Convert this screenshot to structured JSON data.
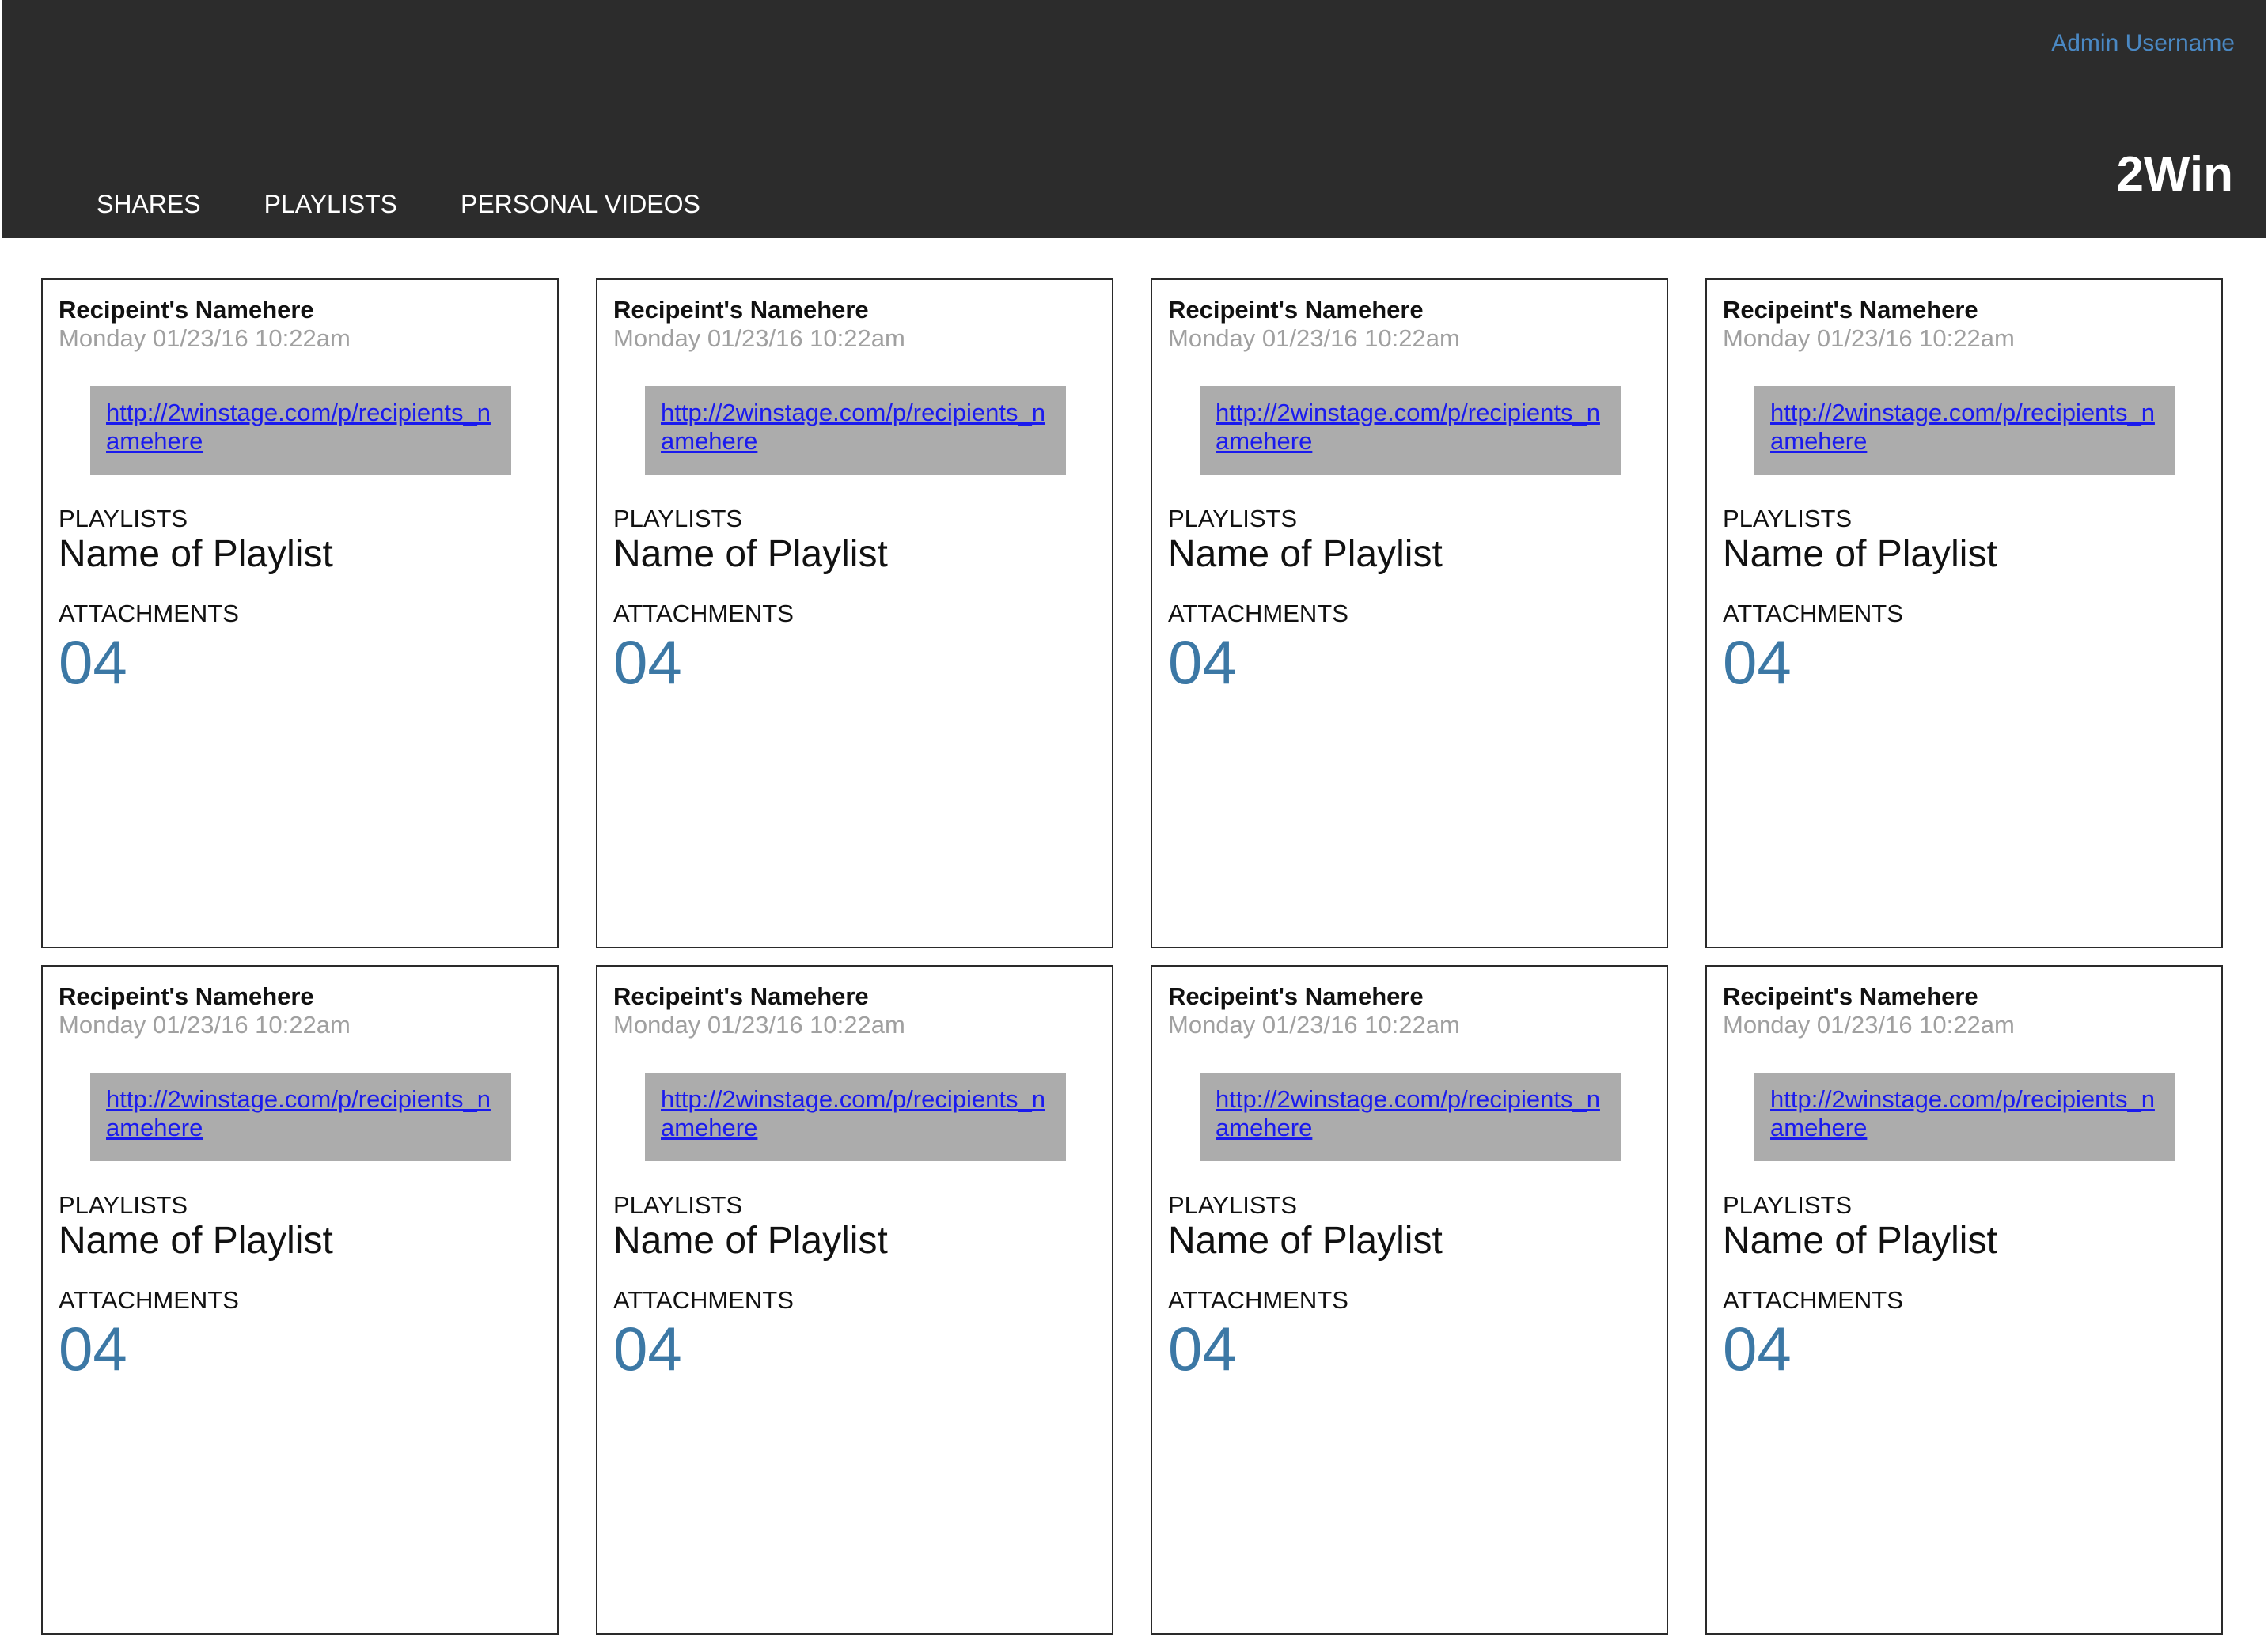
{
  "header": {
    "admin_username": "Admin Username",
    "brand": "2Win",
    "nav": [
      {
        "label": "SHARES"
      },
      {
        "label": "PLAYLISTS"
      },
      {
        "label": "PERSONAL VIDEOS"
      }
    ]
  },
  "labels": {
    "playlists": "PLAYLISTS",
    "attachments": "ATTACHMENTS"
  },
  "cards": [
    {
      "name": "Recipeint's Namehere",
      "date": "Monday 01/23/16 10:22am",
      "link": "http://2winstage.com/p/recipients_namehere",
      "playlist": "Name of Playlist",
      "attachments": "04"
    },
    {
      "name": "Recipeint's Namehere",
      "date": "Monday 01/23/16 10:22am",
      "link": "http://2winstage.com/p/recipients_namehere",
      "playlist": "Name of Playlist",
      "attachments": "04"
    },
    {
      "name": "Recipeint's Namehere",
      "date": "Monday 01/23/16 10:22am",
      "link": "http://2winstage.com/p/recipients_namehere",
      "playlist": "Name of Playlist",
      "attachments": "04"
    },
    {
      "name": "Recipeint's Namehere",
      "date": "Monday 01/23/16 10:22am",
      "link": "http://2winstage.com/p/recipients_namehere",
      "playlist": "Name of Playlist",
      "attachments": "04"
    },
    {
      "name": "Recipeint's Namehere",
      "date": "Monday 01/23/16 10:22am",
      "link": "http://2winstage.com/p/recipients_namehere",
      "playlist": "Name of Playlist",
      "attachments": "04"
    },
    {
      "name": "Recipeint's Namehere",
      "date": "Monday 01/23/16 10:22am",
      "link": "http://2winstage.com/p/recipients_namehere",
      "playlist": "Name of Playlist",
      "attachments": "04"
    },
    {
      "name": "Recipeint's Namehere",
      "date": "Monday 01/23/16 10:22am",
      "link": "http://2winstage.com/p/recipients_namehere",
      "playlist": "Name of Playlist",
      "attachments": "04"
    },
    {
      "name": "Recipeint's Namehere",
      "date": "Monday 01/23/16 10:22am",
      "link": "http://2winstage.com/p/recipients_namehere",
      "playlist": "Name of Playlist",
      "attachments": "04"
    }
  ]
}
